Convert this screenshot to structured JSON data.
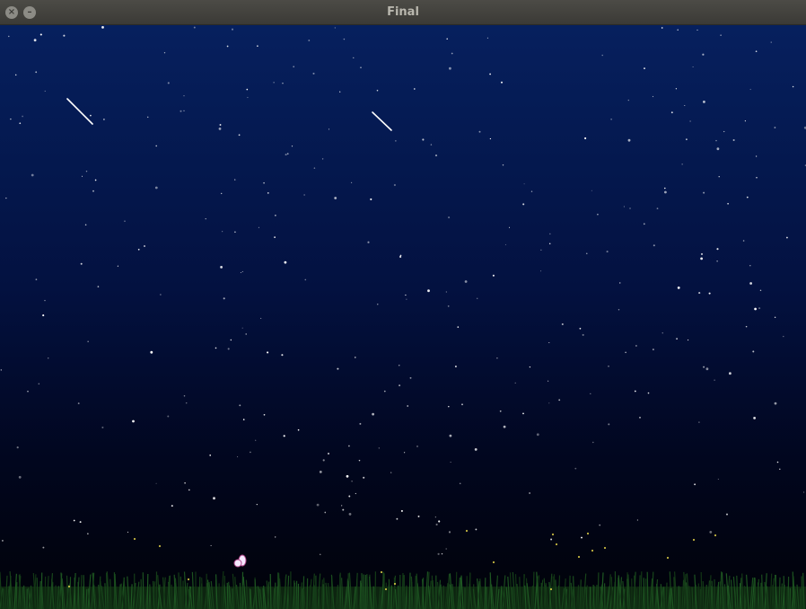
{
  "window": {
    "title": "Final",
    "close_icon": "close-icon",
    "minimize_icon": "minimize-icon"
  },
  "scene": {
    "sky_top_color": "#06205e",
    "sky_bottom_color": "#010208",
    "grass_color": "#1a3a1c",
    "star_color": "#ffffff",
    "firefly_color": "#e8d84a"
  }
}
